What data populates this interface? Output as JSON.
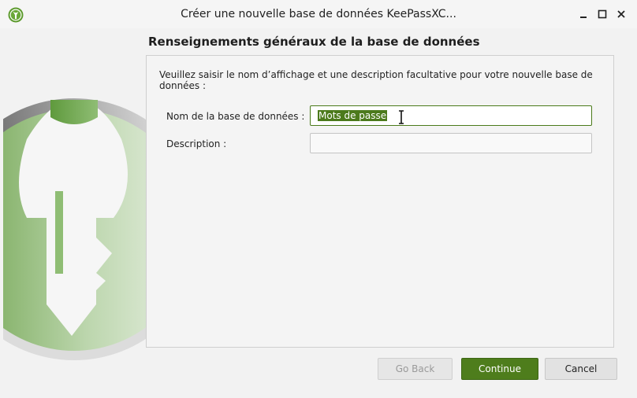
{
  "window": {
    "title": "Créer une nouvelle base de données KeePassXC..."
  },
  "wizard": {
    "heading": "Renseignements généraux de la base de données",
    "intro": "Veuillez saisir le nom d’affichage et une description facultative pour votre nouvelle base de données :",
    "name_label": "Nom de la base de données :",
    "name_value": "Mots de passe",
    "description_label": "Description :",
    "description_value": ""
  },
  "buttons": {
    "back": "Go Back",
    "continue": "Continue",
    "cancel": "Cancel"
  },
  "colors": {
    "accent": "#4e7d1c",
    "selection": "#4c7a1c"
  },
  "icons": {
    "app": "keepassxc-logo-icon",
    "minimize": "minimize-icon",
    "maximize": "maximize-icon",
    "close": "close-icon",
    "cursor": "text-cursor-icon",
    "artwork": "key-illustration"
  }
}
